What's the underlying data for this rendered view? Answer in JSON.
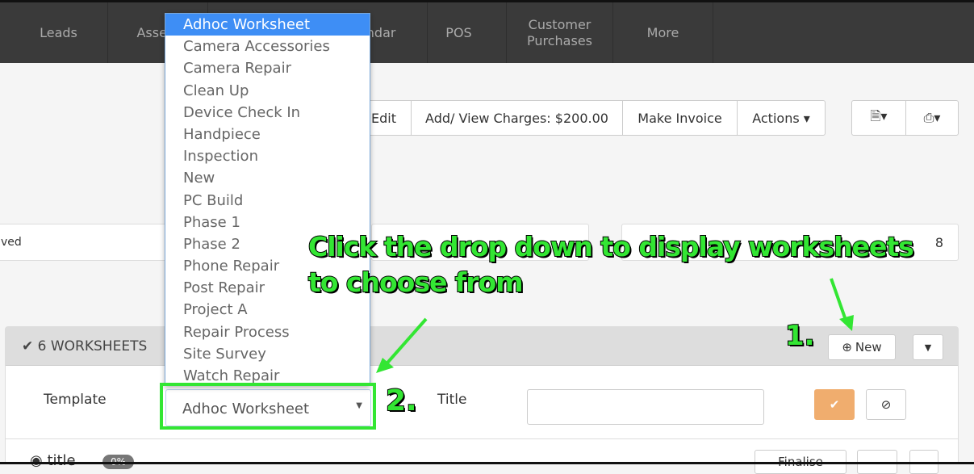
{
  "nav": [
    "Leads",
    "Assets",
    "Calendar",
    "POS",
    "Customer Purchases",
    "More"
  ],
  "toolbar": {
    "edit": "Edit",
    "charges": "Add/ View Charges: $200.00",
    "invoice": "Make Invoice",
    "actions": "Actions ▾",
    "pdf": "🗎▾",
    "print": "⎙▾"
  },
  "fields": {
    "left": "ved",
    "right": "8"
  },
  "dropdown": {
    "options": [
      "Adhoc Worksheet",
      "Camera Accessories",
      "Camera Repair",
      "Clean Up",
      "Device Check In",
      "Handpiece",
      "Inspection",
      "New",
      "PC Build",
      "Phase 1",
      "Phase 2",
      "Phone Repair",
      "Post Repair",
      "Project A",
      "Repair Process",
      "Site Survey",
      "Watch Repair"
    ],
    "selected": "Adhoc Worksheet"
  },
  "panel": {
    "heading": "✔ 6 WORKSHEETS",
    "new": "New",
    "template_label": "Template",
    "title_label": "Title",
    "title_value": "",
    "worksheet": "title",
    "percent": "0%",
    "finalise": "Finalise"
  },
  "annotations": {
    "main": "Click the drop down to display worksheets to choose from",
    "step1": "1.",
    "step2": "2."
  }
}
